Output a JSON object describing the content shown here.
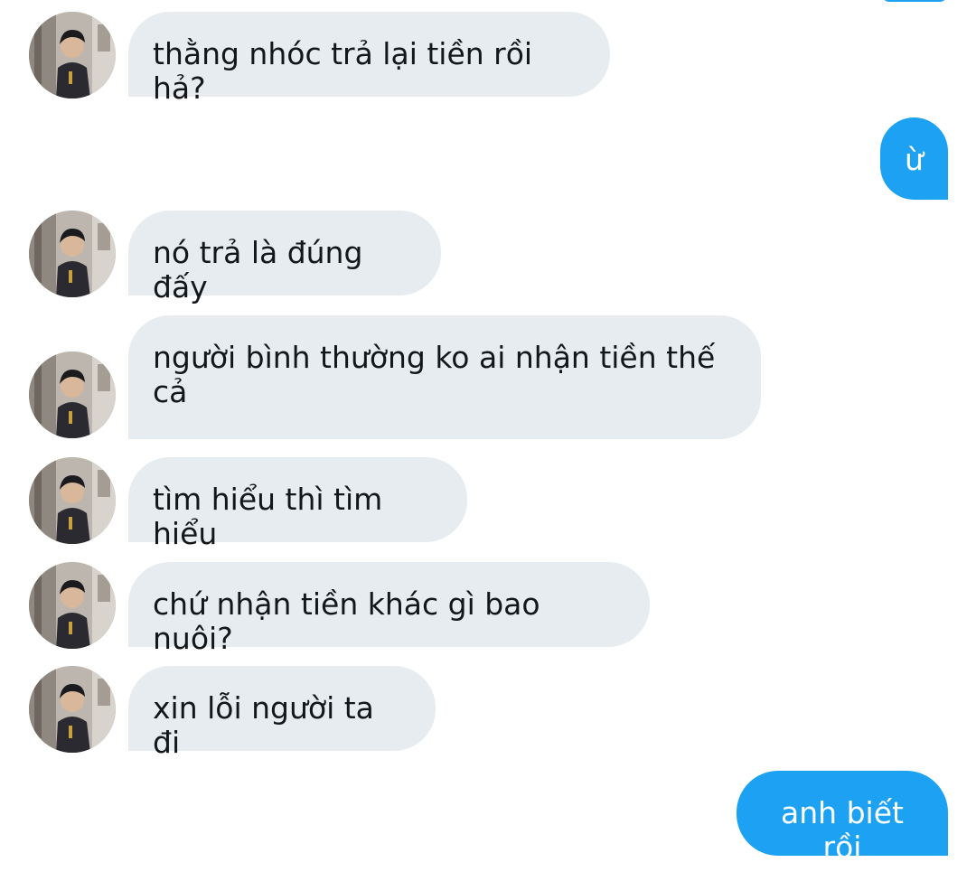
{
  "conversation": {
    "messages": [
      {
        "direction": "received",
        "text": "thằng nhóc trả lại tiền rồi hả?"
      },
      {
        "direction": "sent",
        "text": "ừ"
      },
      {
        "direction": "received",
        "text": "nó trả là đúng đấy"
      },
      {
        "direction": "received",
        "text": "người bình thường ko ai nhận tiền thế cả"
      },
      {
        "direction": "received",
        "text": "tìm hiểu thì tìm hiểu"
      },
      {
        "direction": "received",
        "text": "chứ nhận tiền khác gì bao nuôi?"
      },
      {
        "direction": "received",
        "text": "xin lỗi người ta đi"
      },
      {
        "direction": "sent",
        "text": "anh biết rồi"
      }
    ]
  },
  "colors": {
    "sent_bubble": "#1da1f2",
    "received_bubble": "#e6ecf0",
    "received_text": "#14171a",
    "sent_text": "#ffffff"
  },
  "icons": {
    "avatar": "contact-avatar-photo"
  }
}
